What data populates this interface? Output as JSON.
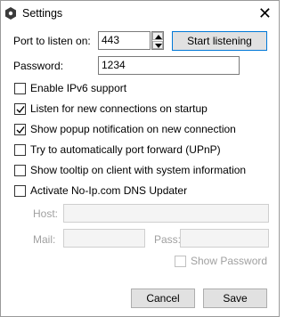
{
  "window": {
    "title": "Settings",
    "close_glyph": "✕"
  },
  "port": {
    "label": "Port to listen on:",
    "value": "443"
  },
  "start_button": {
    "label": "Start listening"
  },
  "password": {
    "label": "Password:",
    "value": "1234"
  },
  "options": [
    {
      "label": "Enable IPv6 support",
      "checked": false
    },
    {
      "label": "Listen for new connections on startup",
      "checked": true
    },
    {
      "label": "Show popup notification on new connection",
      "checked": true
    },
    {
      "label": "Try to automatically port forward (UPnP)",
      "checked": false
    },
    {
      "label": "Show tooltip on client with system information",
      "checked": false
    },
    {
      "label": "Activate No-Ip.com DNS Updater",
      "checked": false
    }
  ],
  "noip": {
    "host_label": "Host:",
    "host_value": "",
    "mail_label": "Mail:",
    "mail_value": "",
    "pass_label": "Pass:",
    "pass_value": "",
    "show_password_label": "Show Password",
    "show_password_checked": false
  },
  "footer": {
    "cancel_label": "Cancel",
    "save_label": "Save"
  },
  "icons": {
    "app": "app-gear-icon",
    "close": "close-icon",
    "spin_up": "chevron-up-icon",
    "spin_down": "chevron-down-icon",
    "check": "checkmark-icon"
  },
  "colors": {
    "focus_border": "#0078d7",
    "disabled_text": "#a0a0a0"
  }
}
